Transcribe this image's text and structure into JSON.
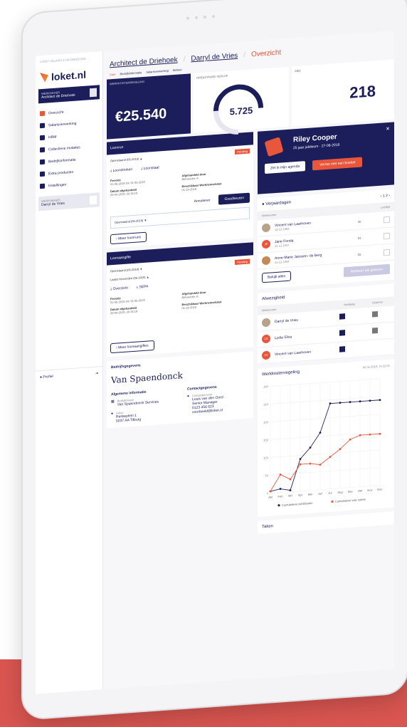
{
  "sidebar": {
    "crumb": "LOKET SALARIS & HR OMGEVING",
    "logo": "loket.nl",
    "org_label": "WERKGEVER",
    "org_name": "Architect de Driehoek",
    "items": [
      {
        "label": "Overzicht",
        "icon": "home-icon",
        "active": true
      },
      {
        "label": "Salarisverwerking",
        "icon": "wallet-icon"
      },
      {
        "label": "HRM",
        "icon": "people-icon"
      },
      {
        "label": "Collectieve mutaties",
        "icon": "grid-icon"
      },
      {
        "label": "Bedrijfsinformatie",
        "icon": "building-icon"
      },
      {
        "label": "Extra producten",
        "icon": "tag-icon"
      },
      {
        "label": "Instellingen",
        "icon": "gear-icon"
      }
    ],
    "user_label": "WERKNEMER",
    "user_name": "Darryl de Vries",
    "profile": "Profiel"
  },
  "breadcrumb": {
    "c1": "Architect de Driehoek",
    "c2": "Darryl de Vries",
    "c3": "Overzicht"
  },
  "tabs": [
    "Start",
    "Bedrijfsinformatie",
    "Salarisverwerking",
    "Beheer"
  ],
  "kpi": {
    "wkr_label": "WERKKOSTENREGELING",
    "wkr_value": "€25.540",
    "verlof_label": "OPENSTAAND VERLOF",
    "verlof_value": "5.725",
    "ziek_label": "ZIEK",
    "ziek_value": "218"
  },
  "loonrun": {
    "title": "Loonrun",
    "period": "Openstaand (05-2019)",
    "status": "Pending",
    "dl1": "Loonstroken",
    "dl2": "Loonstaat",
    "k1": "Periode",
    "v1": "01-05-2019 t/m 31-05-2019",
    "k2": "Afgehandeld door",
    "v2": "Behoerder, A.",
    "k3": "Datum afgehandeld",
    "v3": "29-04-2019, 20:35:19",
    "k4": "Beschikbaar Werknemerloket",
    "v4": "01-19-2019",
    "cancel": "Annuleren",
    "approve": "Goedkeuren",
    "sub_period": "Openstaand (05-2019)",
    "more": "Meer loonruns"
  },
  "loonaangifte": {
    "title": "Loonaangifte",
    "period": "Openstaand (05-2019)",
    "status": "Pending",
    "last": "Laatst Verzonden (05-2019)",
    "dl1": "Overzicht",
    "dl2": "SEPA",
    "k1": "Periode",
    "v1": "01-05-2019 t/m 31-05-2019",
    "k2": "Afgehandeld door",
    "v2": "Behoerder, A.",
    "k3": "Datum afgehandeld",
    "v3": "29-04-2019, 20:35:19",
    "k4": "Beschikbaar Werknemerloket",
    "v4": "01-19-2019",
    "more": "Meer loonaangiftes"
  },
  "company": {
    "title": "Bedrijfsgegevens",
    "logo_text": "Van Spaendonck",
    "general": "Algemene informatie",
    "contact": "Contactgegevens",
    "company_label": "Bedrijfsnaam",
    "company_name": "Van Spaendonck Services",
    "contact_label": "Contactpersoon",
    "contact_name": "Louis van den Oord",
    "contact_role": "Senior Manager",
    "phone": "0123 456 623",
    "email": "voorbeeld@loket.nl",
    "addr_label": "Adres",
    "addr1": "Reitseplein 1",
    "addr2": "5037 AA Tilburg"
  },
  "event": {
    "name": "Riley Cooper",
    "sub": "25 jaar jubileum · 27-08-2019",
    "add": "Zet in mijn agenda",
    "surprise": "Verras met een boeket"
  },
  "birthdays": {
    "title": "Verjaardagen",
    "page": "1",
    "pages": "2",
    "col1": "Werknemer",
    "col2": "Leeftijd",
    "rows": [
      {
        "name": "Vincent van Laarhoven",
        "date": "14-12-1983",
        "age": "35"
      },
      {
        "name": "Jane Fonda",
        "date": "21-12-1937",
        "age": "81",
        "initials": "JF"
      },
      {
        "name": "Anne-Marie Janssen- de Berg",
        "date": "21-12-1994",
        "age": "25"
      }
    ],
    "view": "Bekijk alles",
    "mark": "Markeer als gelezen"
  },
  "absence": {
    "title": "Afwezigheid",
    "col1": "Werknemer",
    "col2": "Vandaag",
    "col3": "Gisteren",
    "rows": [
      {
        "name": "Darryl de Vries"
      },
      {
        "name": "Lydia Silva",
        "initials": "LS"
      },
      {
        "name": "Vincent van Laarhoven",
        "initials": "VV"
      }
    ]
  },
  "chart_data": {
    "type": "line",
    "title": "Werkkostenregeling",
    "timestamp": "06-11-2019, 14:32:01",
    "categories": [
      "Jan",
      "Feb",
      "Mrt",
      "Apr",
      "Mei",
      "Jun",
      "Jul",
      "Aug",
      "Sep",
      "Okt",
      "Nov",
      "Dec"
    ],
    "ylim": [
      0,
      300
    ],
    "yticks": [
      0,
      50,
      100,
      150,
      200,
      250,
      300
    ],
    "series": [
      {
        "name": "Cumulatieve werkkosten",
        "color": "#1b1e5a",
        "values": [
          5,
          10,
          4,
          90,
          120,
          160,
          240,
          240,
          240,
          240,
          240,
          240
        ]
      },
      {
        "name": "Cumulatieve vrije ruimte",
        "color": "#e8573c",
        "values": [
          5,
          50,
          35,
          75,
          75,
          70,
          90,
          110,
          135,
          145,
          145,
          145
        ]
      }
    ]
  },
  "tasks": {
    "title": "Taken"
  }
}
